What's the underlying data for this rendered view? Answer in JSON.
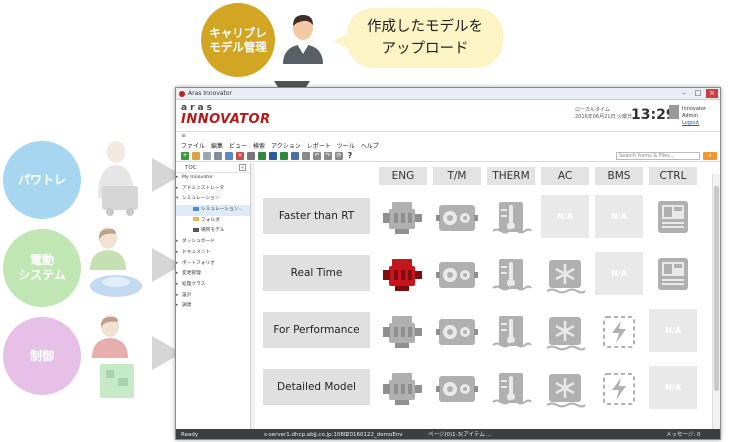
{
  "infographic": {
    "top_circle": {
      "line1": "キャリブレ",
      "line2": "モデル管理",
      "color": "#d2a623"
    },
    "bubble": {
      "line1": "作成したモデルを",
      "line2": "アップロード"
    },
    "left_circles": [
      {
        "label": "パワトレ",
        "color": "#a7d7f0"
      },
      {
        "label_line1": "電動",
        "label_line2": "システム",
        "color": "#bfe6b3"
      },
      {
        "label": "制御",
        "color": "#e7c0e8"
      }
    ]
  },
  "window": {
    "title": "Aras Innovator",
    "brand_top": "aras",
    "brand_name": "INNOVATOR",
    "locale_line1": "ローカルタイム",
    "locale_line2": "2016年06月21日 火曜日",
    "time": "13:29",
    "user_name": "Innovator Admin",
    "logout": "Logout",
    "menu": [
      "ファイル",
      "編集",
      "ビュー",
      "検索",
      "アクション",
      "レポート",
      "ツール",
      "ヘルプ"
    ],
    "search_placeholder": "Search Items & Files...",
    "toc_title": "TOC",
    "toc_items": [
      {
        "label": "My Innovator",
        "level": 0
      },
      {
        "label": "アドミニストレータ",
        "level": 0
      },
      {
        "label": "シミュレーション",
        "level": 0
      },
      {
        "label": "シミュレーション...",
        "level": 1,
        "icon_color": "#4a8fd6",
        "highlight": true
      },
      {
        "label": "フォルダ",
        "level": 1,
        "icon_color": "#e8b84a"
      },
      {
        "label": "場所モデル",
        "level": 1,
        "icon_color": "#555555"
      },
      {
        "label": "ダッシュボード",
        "level": 0
      },
      {
        "label": "ドキュメント",
        "level": 0
      },
      {
        "label": "ポートフォリオ",
        "level": 0
      },
      {
        "label": "変更管理",
        "level": 0
      },
      {
        "label": "処理クラス",
        "level": 0
      },
      {
        "label": "設計",
        "level": 0
      },
      {
        "label": "調達",
        "level": 0
      }
    ],
    "status": {
      "left": "Ready",
      "server": "s-server1.dhcp.abjj.co.jp:1080",
      "db": "20160122_demoEnv",
      "page": "ページ(0)1-3(アイテム",
      "dots": "...",
      "messages": "メッセージ: 0"
    }
  },
  "grid": {
    "columns": [
      "ENG",
      "T/M",
      "THERM",
      "AC",
      "BMS",
      "CTRL"
    ],
    "rows": [
      {
        "label": "Faster than RT",
        "cells": [
          "engine",
          "transmission",
          "thermal",
          "na",
          "na",
          "controller"
        ]
      },
      {
        "label": "Real Time",
        "cells": [
          "engine-active",
          "transmission",
          "thermal",
          "ac",
          "na",
          "controller"
        ]
      },
      {
        "label": "For Performance",
        "cells": [
          "engine",
          "transmission",
          "thermal",
          "ac",
          "bms",
          "na"
        ]
      },
      {
        "label": "Detailed Model",
        "cells": [
          "engine",
          "transmission",
          "thermal",
          "ac",
          "bms",
          "na"
        ]
      }
    ],
    "na_label": "N/A",
    "icon_color": "#b0b0b0",
    "active_color": "#c4161c"
  }
}
